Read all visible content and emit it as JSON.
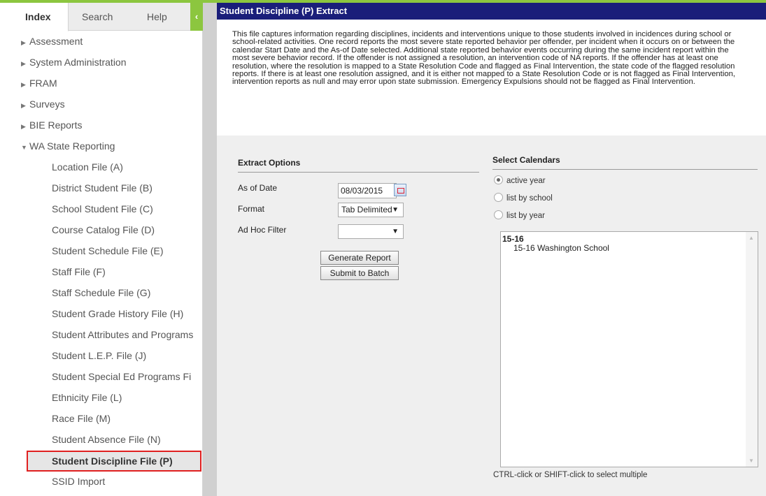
{
  "nav": {
    "tabs": {
      "index": "Index",
      "search": "Search",
      "help": "Help"
    },
    "collapse_glyph": "‹",
    "tree": [
      {
        "label": "Assessment",
        "level": 1,
        "state": "collapsed"
      },
      {
        "label": "System Administration",
        "level": 1,
        "state": "collapsed"
      },
      {
        "label": "FRAM",
        "level": 1,
        "state": "collapsed"
      },
      {
        "label": "Surveys",
        "level": 1,
        "state": "collapsed"
      },
      {
        "label": "BIE Reports",
        "level": 1,
        "state": "collapsed"
      },
      {
        "label": "WA State Reporting",
        "level": 1,
        "state": "expanded"
      },
      {
        "label": "Location File (A)",
        "level": 2
      },
      {
        "label": "District Student File (B)",
        "level": 2
      },
      {
        "label": "School Student File (C)",
        "level": 2
      },
      {
        "label": "Course Catalog File (D)",
        "level": 2
      },
      {
        "label": "Student Schedule File (E)",
        "level": 2
      },
      {
        "label": "Staff File (F)",
        "level": 2
      },
      {
        "label": "Staff Schedule File (G)",
        "level": 2
      },
      {
        "label": "Student Grade History File (H)",
        "level": 2
      },
      {
        "label": "Student Attributes and Programs",
        "level": 2
      },
      {
        "label": "Student L.E.P. File (J)",
        "level": 2
      },
      {
        "label": "Student Special Ed Programs Fi",
        "level": 2
      },
      {
        "label": "Ethnicity File (L)",
        "level": 2
      },
      {
        "label": "Race File (M)",
        "level": 2
      },
      {
        "label": "Student Absence File (N)",
        "level": 2
      },
      {
        "label": "Student Discipline File (P)",
        "level": 2,
        "selected": true
      },
      {
        "label": "SSID Import",
        "level": 2
      }
    ]
  },
  "main": {
    "title": "Student Discipline (P) Extract",
    "description": "This file captures information regarding disciplines, incidents and interventions unique to those students involved in incidences during school or school-related activities. One record reports the most severe state reported behavior per offender, per incident when it occurs on or between the calendar Start Date and the As-of Date selected. Additional state reported behavior events occurring during the same incident report within the most severe behavior record. If the offender is not assigned a resolution, an intervention code of NA reports. If the offender has at least one resolution, where the resolution is mapped to a State Resolution Code and flagged as Final Intervention, the state code of the flagged resolution reports. If there is at least one resolution assigned, and it is either not mapped to a State Resolution Code or is not flagged as Final Intervention, intervention reports as null and may error upon state submission. Emergency Expulsions should not be flagged as Final Intervention.",
    "extract_options": {
      "heading": "Extract Options",
      "as_of_date_label": "As of Date",
      "as_of_date_value": "08/03/2015",
      "format_label": "Format",
      "format_value": "Tab Delimited",
      "ad_hoc_label": "Ad Hoc Filter",
      "ad_hoc_value": "",
      "generate_button": "Generate Report",
      "batch_button": "Submit to Batch"
    },
    "calendars": {
      "heading": "Select Calendars",
      "radios": [
        {
          "label": "active year",
          "checked": true
        },
        {
          "label": "list by school",
          "checked": false
        },
        {
          "label": "list by year",
          "checked": false
        }
      ],
      "group_label": "15-16",
      "option": "15-16 Washington School",
      "hint": "CTRL-click or SHIFT-click to select multiple"
    }
  },
  "colors": {
    "accent_green": "#8cc63f",
    "header_navy": "#1a1e7a",
    "selection_border": "#e02020"
  }
}
